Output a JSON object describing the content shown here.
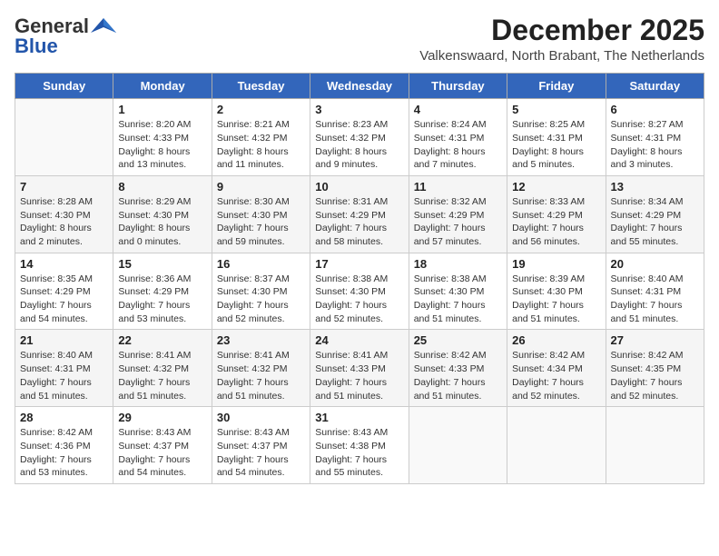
{
  "logo": {
    "general": "General",
    "blue": "Blue"
  },
  "title": "December 2025",
  "subtitle": "Valkenswaard, North Brabant, The Netherlands",
  "days_header": [
    "Sunday",
    "Monday",
    "Tuesday",
    "Wednesday",
    "Thursday",
    "Friday",
    "Saturday"
  ],
  "weeks": [
    [
      {
        "day": "",
        "info": ""
      },
      {
        "day": "1",
        "info": "Sunrise: 8:20 AM\nSunset: 4:33 PM\nDaylight: 8 hours\nand 13 minutes."
      },
      {
        "day": "2",
        "info": "Sunrise: 8:21 AM\nSunset: 4:32 PM\nDaylight: 8 hours\nand 11 minutes."
      },
      {
        "day": "3",
        "info": "Sunrise: 8:23 AM\nSunset: 4:32 PM\nDaylight: 8 hours\nand 9 minutes."
      },
      {
        "day": "4",
        "info": "Sunrise: 8:24 AM\nSunset: 4:31 PM\nDaylight: 8 hours\nand 7 minutes."
      },
      {
        "day": "5",
        "info": "Sunrise: 8:25 AM\nSunset: 4:31 PM\nDaylight: 8 hours\nand 5 minutes."
      },
      {
        "day": "6",
        "info": "Sunrise: 8:27 AM\nSunset: 4:31 PM\nDaylight: 8 hours\nand 3 minutes."
      }
    ],
    [
      {
        "day": "7",
        "info": "Sunrise: 8:28 AM\nSunset: 4:30 PM\nDaylight: 8 hours\nand 2 minutes."
      },
      {
        "day": "8",
        "info": "Sunrise: 8:29 AM\nSunset: 4:30 PM\nDaylight: 8 hours\nand 0 minutes."
      },
      {
        "day": "9",
        "info": "Sunrise: 8:30 AM\nSunset: 4:30 PM\nDaylight: 7 hours\nand 59 minutes."
      },
      {
        "day": "10",
        "info": "Sunrise: 8:31 AM\nSunset: 4:29 PM\nDaylight: 7 hours\nand 58 minutes."
      },
      {
        "day": "11",
        "info": "Sunrise: 8:32 AM\nSunset: 4:29 PM\nDaylight: 7 hours\nand 57 minutes."
      },
      {
        "day": "12",
        "info": "Sunrise: 8:33 AM\nSunset: 4:29 PM\nDaylight: 7 hours\nand 56 minutes."
      },
      {
        "day": "13",
        "info": "Sunrise: 8:34 AM\nSunset: 4:29 PM\nDaylight: 7 hours\nand 55 minutes."
      }
    ],
    [
      {
        "day": "14",
        "info": "Sunrise: 8:35 AM\nSunset: 4:29 PM\nDaylight: 7 hours\nand 54 minutes."
      },
      {
        "day": "15",
        "info": "Sunrise: 8:36 AM\nSunset: 4:29 PM\nDaylight: 7 hours\nand 53 minutes."
      },
      {
        "day": "16",
        "info": "Sunrise: 8:37 AM\nSunset: 4:30 PM\nDaylight: 7 hours\nand 52 minutes."
      },
      {
        "day": "17",
        "info": "Sunrise: 8:38 AM\nSunset: 4:30 PM\nDaylight: 7 hours\nand 52 minutes."
      },
      {
        "day": "18",
        "info": "Sunrise: 8:38 AM\nSunset: 4:30 PM\nDaylight: 7 hours\nand 51 minutes."
      },
      {
        "day": "19",
        "info": "Sunrise: 8:39 AM\nSunset: 4:30 PM\nDaylight: 7 hours\nand 51 minutes."
      },
      {
        "day": "20",
        "info": "Sunrise: 8:40 AM\nSunset: 4:31 PM\nDaylight: 7 hours\nand 51 minutes."
      }
    ],
    [
      {
        "day": "21",
        "info": "Sunrise: 8:40 AM\nSunset: 4:31 PM\nDaylight: 7 hours\nand 51 minutes."
      },
      {
        "day": "22",
        "info": "Sunrise: 8:41 AM\nSunset: 4:32 PM\nDaylight: 7 hours\nand 51 minutes."
      },
      {
        "day": "23",
        "info": "Sunrise: 8:41 AM\nSunset: 4:32 PM\nDaylight: 7 hours\nand 51 minutes."
      },
      {
        "day": "24",
        "info": "Sunrise: 8:41 AM\nSunset: 4:33 PM\nDaylight: 7 hours\nand 51 minutes."
      },
      {
        "day": "25",
        "info": "Sunrise: 8:42 AM\nSunset: 4:33 PM\nDaylight: 7 hours\nand 51 minutes."
      },
      {
        "day": "26",
        "info": "Sunrise: 8:42 AM\nSunset: 4:34 PM\nDaylight: 7 hours\nand 52 minutes."
      },
      {
        "day": "27",
        "info": "Sunrise: 8:42 AM\nSunset: 4:35 PM\nDaylight: 7 hours\nand 52 minutes."
      }
    ],
    [
      {
        "day": "28",
        "info": "Sunrise: 8:42 AM\nSunset: 4:36 PM\nDaylight: 7 hours\nand 53 minutes."
      },
      {
        "day": "29",
        "info": "Sunrise: 8:43 AM\nSunset: 4:37 PM\nDaylight: 7 hours\nand 54 minutes."
      },
      {
        "day": "30",
        "info": "Sunrise: 8:43 AM\nSunset: 4:37 PM\nDaylight: 7 hours\nand 54 minutes."
      },
      {
        "day": "31",
        "info": "Sunrise: 8:43 AM\nSunset: 4:38 PM\nDaylight: 7 hours\nand 55 minutes."
      },
      {
        "day": "",
        "info": ""
      },
      {
        "day": "",
        "info": ""
      },
      {
        "day": "",
        "info": ""
      }
    ]
  ]
}
